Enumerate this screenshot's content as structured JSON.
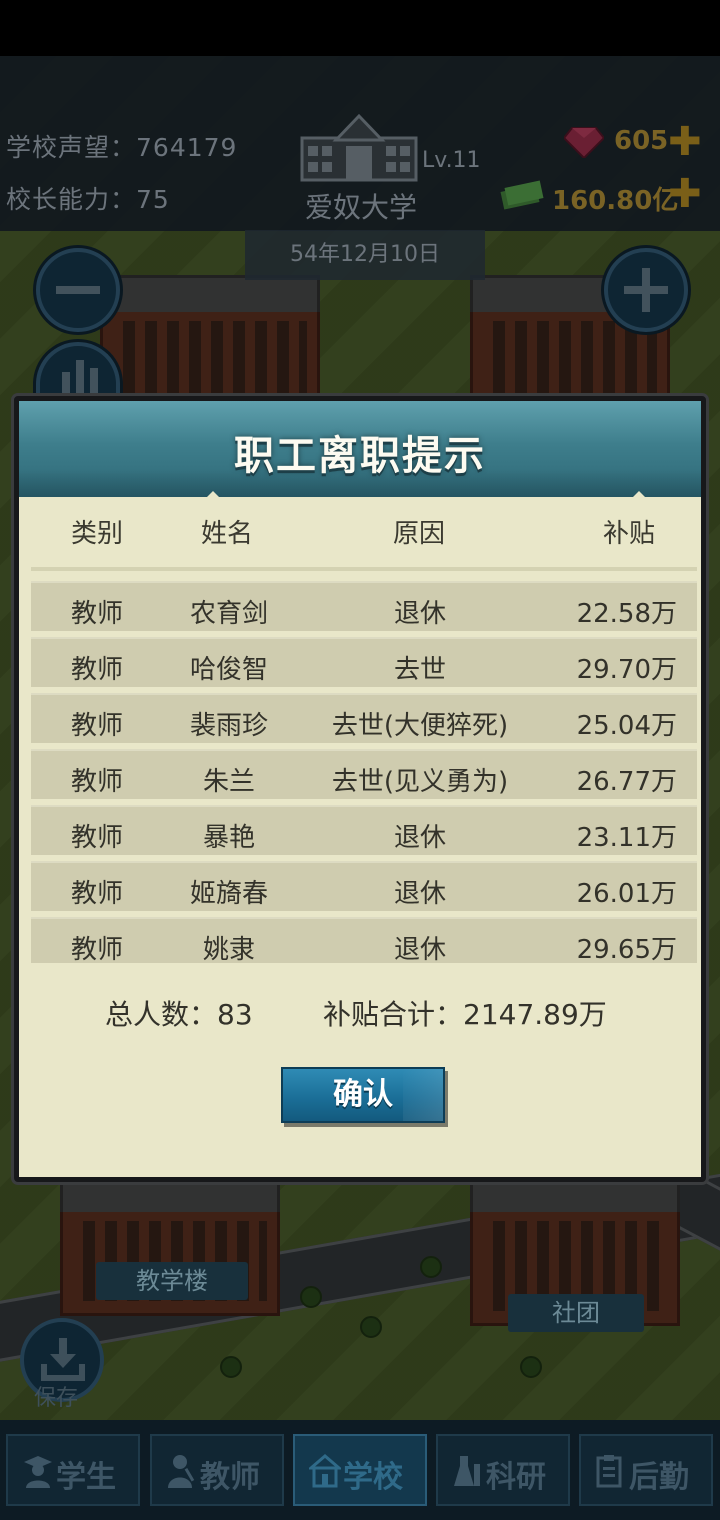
{
  "hud": {
    "reputation_label": "学校声望：",
    "reputation_value": "764179",
    "ability_label": "校长能力：",
    "ability_value": "75",
    "level": "Lv.11",
    "school_name": "爱奴大学",
    "date": "54年12月10日",
    "gems": "605",
    "money": "160.80亿",
    "icons": [
      "school-building-icon",
      "gem-icon",
      "money-icon",
      "plus-icon"
    ]
  },
  "modal": {
    "title": "职工离职提示",
    "columns": [
      "类别",
      "姓名",
      "原因",
      "补贴"
    ],
    "rows": [
      {
        "category": "教师",
        "name": "农育剑",
        "reason": "退休",
        "subsidy": "22.58万"
      },
      {
        "category": "教师",
        "name": "哈俊智",
        "reason": "去世",
        "subsidy": "29.70万"
      },
      {
        "category": "教师",
        "name": "裴雨珍",
        "reason": "去世(大便猝死)",
        "subsidy": "25.04万"
      },
      {
        "category": "教师",
        "name": "朱兰",
        "reason": "去世(见义勇为)",
        "subsidy": "26.77万"
      },
      {
        "category": "教师",
        "name": "暴艳",
        "reason": "退休",
        "subsidy": "23.11万"
      },
      {
        "category": "教师",
        "name": "姬旖春",
        "reason": "退休",
        "subsidy": "26.01万"
      },
      {
        "category": "教师",
        "name": "姚隶",
        "reason": "退休",
        "subsidy": "29.65万"
      }
    ],
    "total_label": "总人数：",
    "total_value": "83",
    "subsidy_total_label": "补贴合计：",
    "subsidy_total_value": "2147.89万",
    "confirm_label": "确认"
  },
  "map": {
    "label_teaching": "教学楼",
    "label_club": "社团",
    "save_label": "保存"
  },
  "nav": {
    "items": [
      {
        "label": "学生",
        "icon": "student-icon",
        "active": false
      },
      {
        "label": "教师",
        "icon": "teacher-icon",
        "active": false
      },
      {
        "label": "学校",
        "icon": "school-icon",
        "active": true
      },
      {
        "label": "科研",
        "icon": "flask-icon",
        "active": false
      },
      {
        "label": "后勤",
        "icon": "clipboard-icon",
        "active": false
      }
    ]
  },
  "colors": {
    "modal_bg": "#e9e7c9",
    "row_bg": "#cfccaf",
    "header_teal": "#3e7e8c",
    "confirm_blue": "#1b6f98",
    "nav_bg": "#0d1b24"
  }
}
